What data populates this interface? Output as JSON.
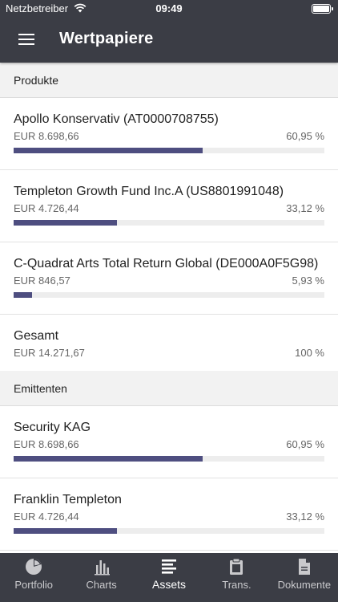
{
  "status_bar": {
    "carrier": "Netzbetreiber",
    "time": "09:49"
  },
  "header": {
    "title": "Wertpapiere"
  },
  "sections": [
    {
      "title": "Produkte",
      "items": [
        {
          "name": "Apollo Konservativ (AT0000708755)",
          "amount": "EUR 8.698,66",
          "percent": "60,95 %",
          "share": 0.6095
        },
        {
          "name": "Templeton Growth Fund Inc.A (US8801991048)",
          "amount": "EUR 4.726,44",
          "percent": "33,12 %",
          "share": 0.3312
        },
        {
          "name": "C-Quadrat Arts Total Return Global (DE000A0F5G98)",
          "amount": "EUR 846,57",
          "percent": "5,93 %",
          "share": 0.0593
        }
      ],
      "total": {
        "name": "Gesamt",
        "amount": "EUR 14.271,67",
        "percent": "100 %"
      }
    },
    {
      "title": "Emittenten",
      "items": [
        {
          "name": "Security KAG",
          "amount": "EUR 8.698,66",
          "percent": "60,95 %",
          "share": 0.6095
        },
        {
          "name": "Franklin Templeton",
          "amount": "EUR 4.726,44",
          "percent": "33,12 %",
          "share": 0.3312
        }
      ]
    }
  ],
  "tabs": [
    {
      "label": "Portfolio",
      "icon": "pie-chart-icon",
      "active": false
    },
    {
      "label": "Charts",
      "icon": "bar-chart-icon",
      "active": false
    },
    {
      "label": "Assets",
      "icon": "list-icon",
      "active": true
    },
    {
      "label": "Trans.",
      "icon": "clipboard-icon",
      "active": false
    },
    {
      "label": "Dokumente",
      "icon": "document-icon",
      "active": false
    }
  ],
  "colors": {
    "header_bg": "#3b3d45",
    "bar_fill": "#4e4e80",
    "bar_track": "#ededed",
    "section_bg": "#f2f2f2"
  }
}
